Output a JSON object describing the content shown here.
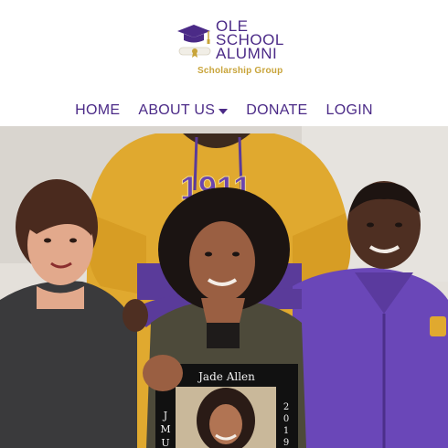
{
  "brand": {
    "name_line1": "OLE",
    "name_line2": "SCHOOL",
    "name_line3": "ALUMNI",
    "tagline": "Scholarship Group",
    "logo_icon": "graduation-cap-diploma-icon",
    "primary_color": "#4b2a87",
    "accent_color": "#c8a43a"
  },
  "nav": {
    "items": [
      {
        "label": "HOME"
      },
      {
        "label": "ABOUT US",
        "dropdown": true
      },
      {
        "label": "DONATE"
      },
      {
        "label": "LOGIN"
      }
    ]
  },
  "hero": {
    "hoodie_text": "1911",
    "frame_name": "Jade Allen",
    "frame_left_letters": "J M U",
    "frame_right_letters": "2 0 1 9"
  }
}
